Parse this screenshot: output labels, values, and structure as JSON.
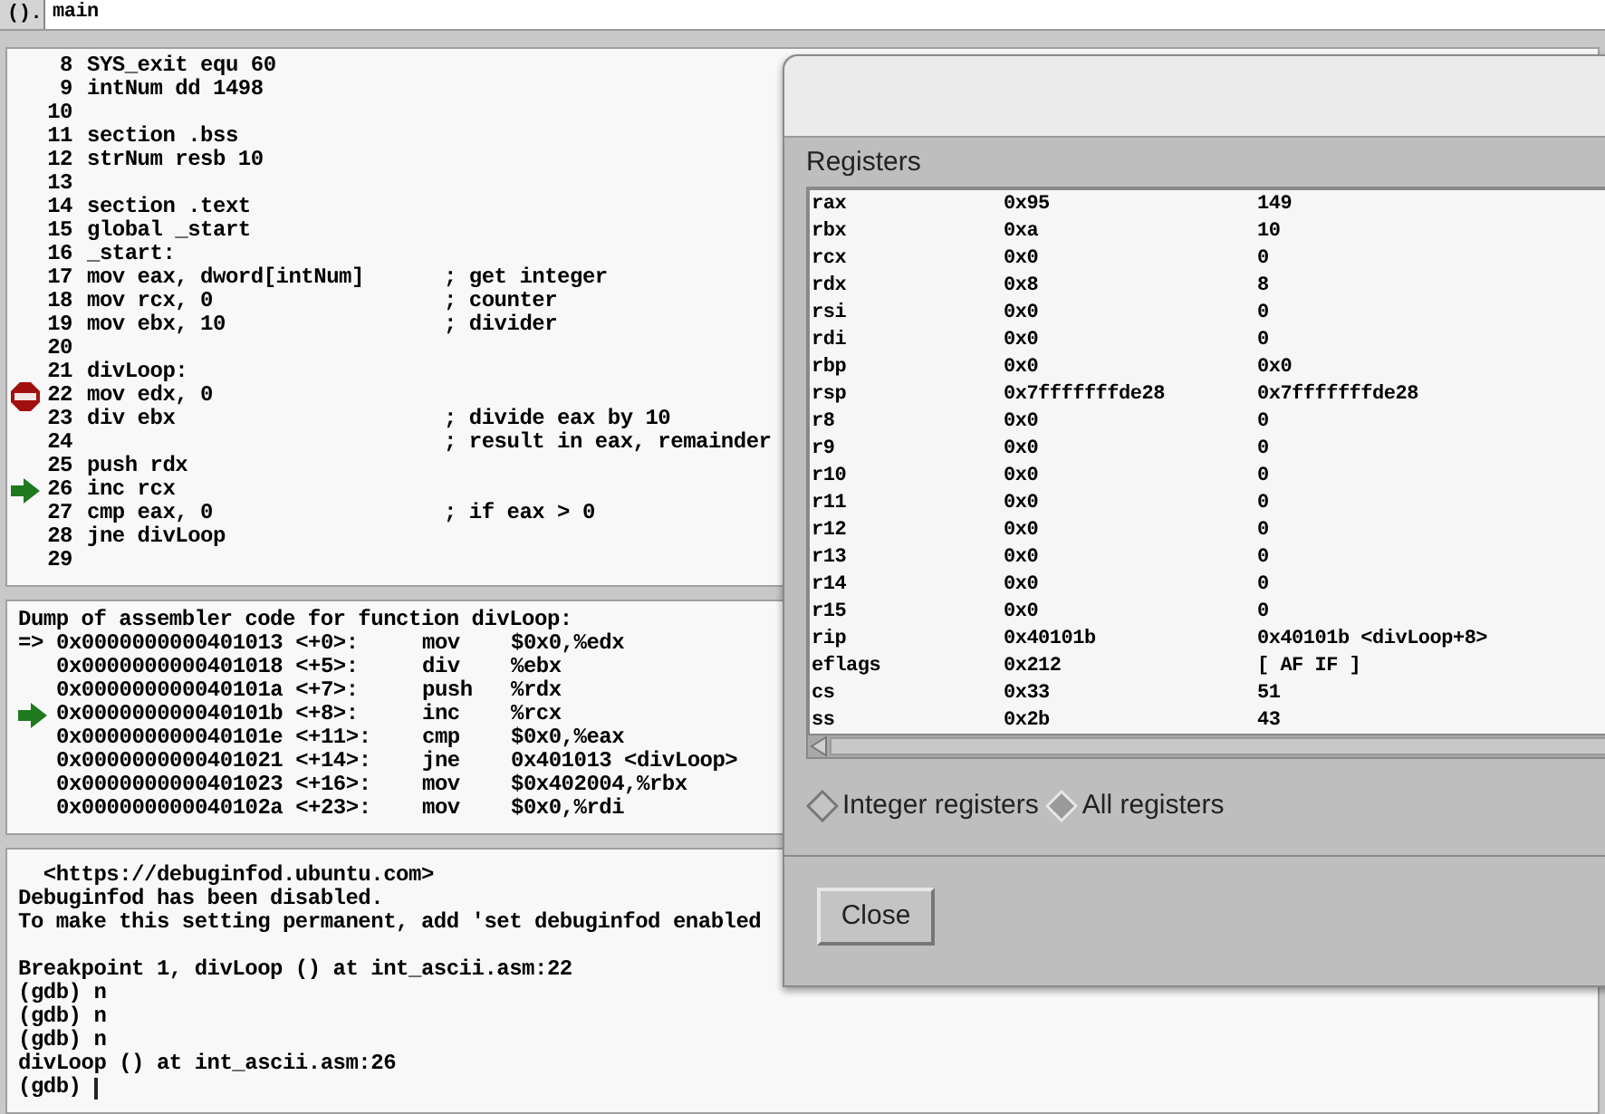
{
  "toolbar": {
    "argument_button": "().",
    "argument_field": "main"
  },
  "source": [
    {
      "line": "8",
      "code": "SYS_exit equ 60",
      "breakpoint": false,
      "current": false
    },
    {
      "line": "9",
      "code": "intNum dd 1498",
      "breakpoint": false,
      "current": false
    },
    {
      "line": "10",
      "breakpoint": false,
      "current": false
    },
    {
      "line": "11",
      "code": "section .bss",
      "breakpoint": false,
      "current": false
    },
    {
      "line": "12",
      "code": "strNum resb 10",
      "breakpoint": false,
      "current": false
    },
    {
      "line": "13",
      "breakpoint": false,
      "current": false
    },
    {
      "line": "14",
      "code": "section .text",
      "breakpoint": false,
      "current": false
    },
    {
      "line": "15",
      "code": "global _start",
      "breakpoint": false,
      "current": false
    },
    {
      "line": "16",
      "code": "_start:",
      "breakpoint": false,
      "current": false
    },
    {
      "line": "17",
      "code": "mov eax, dword[intNum]",
      "comment": "; get integer",
      "breakpoint": false,
      "current": false
    },
    {
      "line": "18",
      "code": "mov rcx, 0",
      "comment": "; counter",
      "breakpoint": false,
      "current": false
    },
    {
      "line": "19",
      "code": "mov ebx, 10",
      "comment": "; divider",
      "breakpoint": false,
      "current": false
    },
    {
      "line": "20",
      "breakpoint": false,
      "current": false
    },
    {
      "line": "21",
      "code": "divLoop:",
      "breakpoint": false,
      "current": false
    },
    {
      "line": "22",
      "code": "mov edx, 0",
      "breakpoint": true,
      "current": false
    },
    {
      "line": "23",
      "code": "div ebx",
      "comment": "; divide eax by 10",
      "breakpoint": false,
      "current": false
    },
    {
      "line": "24",
      "comment": "; result in eax, remainder",
      "breakpoint": false,
      "current": false
    },
    {
      "line": "25",
      "code": "push rdx",
      "breakpoint": false,
      "current": false
    },
    {
      "line": "26",
      "code": "inc rcx",
      "breakpoint": false,
      "current": true
    },
    {
      "line": "27",
      "code": "cmp eax, 0",
      "comment": "; if eax > 0",
      "breakpoint": false,
      "current": false
    },
    {
      "line": "28",
      "code": "jne divLoop",
      "breakpoint": false,
      "current": false
    },
    {
      "line": "29",
      "breakpoint": false,
      "current": false
    }
  ],
  "disassembly": {
    "header": "Dump of assembler code for function divLoop:",
    "rows": [
      {
        "marker": "=>",
        "address": "0x0000000000401013 <+0>:",
        "mnemonic": "mov",
        "operands": "$0x0,%edx",
        "current": false
      },
      {
        "address": "0x0000000000401018 <+5>:",
        "mnemonic": "div",
        "operands": "%ebx",
        "current": false
      },
      {
        "address": "0x000000000040101a <+7>:",
        "mnemonic": "push",
        "operands": "%rdx",
        "current": false
      },
      {
        "address": "0x000000000040101b <+8>:",
        "mnemonic": "inc",
        "operands": "%rcx",
        "current": true
      },
      {
        "address": "0x000000000040101e <+11>:",
        "mnemonic": "cmp",
        "operands": "$0x0,%eax",
        "current": false
      },
      {
        "address": "0x0000000000401021 <+14>:",
        "mnemonic": "jne",
        "operands": "0x401013 <divLoop>",
        "current": false
      },
      {
        "address": "0x0000000000401023 <+16>:",
        "mnemonic": "mov",
        "operands": "$0x402004,%rbx",
        "current": false
      },
      {
        "address": "0x000000000040102a <+23>:",
        "mnemonic": "mov",
        "operands": "$0x0,%rdi",
        "current": false
      }
    ]
  },
  "console": [
    [
      "  <https://debuginfod.ubuntu.com>",
      "Debuginfod has been disabled.",
      "To make this setting permanent, add 'set debuginfod enabled"
    ],
    [
      "Breakpoint 1, divLoop () at int_ascii.asm:22",
      "(gdb) n",
      "(gdb) n",
      "(gdb) n",
      "divLoop () at int_ascii.asm:26",
      "(gdb) "
    ]
  ],
  "registers_dialog": {
    "label": "Registers",
    "rows": [
      [
        "rax",
        "0x95",
        "149"
      ],
      [
        "rbx",
        "0xa",
        "10"
      ],
      [
        "rcx",
        "0x0",
        "0"
      ],
      [
        "rdx",
        "0x8",
        "8"
      ],
      [
        "rsi",
        "0x0",
        "0"
      ],
      [
        "rdi",
        "0x0",
        "0"
      ],
      [
        "rbp",
        "0x0",
        "0x0"
      ],
      [
        "rsp",
        "0x7fffffffde28",
        "0x7fffffffde28"
      ],
      [
        "r8",
        "0x0",
        "0"
      ],
      [
        "r9",
        "0x0",
        "0"
      ],
      [
        "r10",
        "0x0",
        "0"
      ],
      [
        "r11",
        "0x0",
        "0"
      ],
      [
        "r12",
        "0x0",
        "0"
      ],
      [
        "r13",
        "0x0",
        "0"
      ],
      [
        "r14",
        "0x0",
        "0"
      ],
      [
        "r15",
        "0x0",
        "0"
      ],
      [
        "rip",
        "0x40101b",
        "0x40101b <divLoop+8>"
      ],
      [
        "eflags",
        "0x212",
        "[ AF IF ]"
      ],
      [
        "cs",
        "0x33",
        "51"
      ],
      [
        "ss",
        "0x2b",
        "43"
      ]
    ],
    "options": [
      {
        "label": "Integer registers",
        "selected": false
      },
      {
        "label": "All registers",
        "selected": true
      }
    ],
    "close_button": "Close"
  }
}
